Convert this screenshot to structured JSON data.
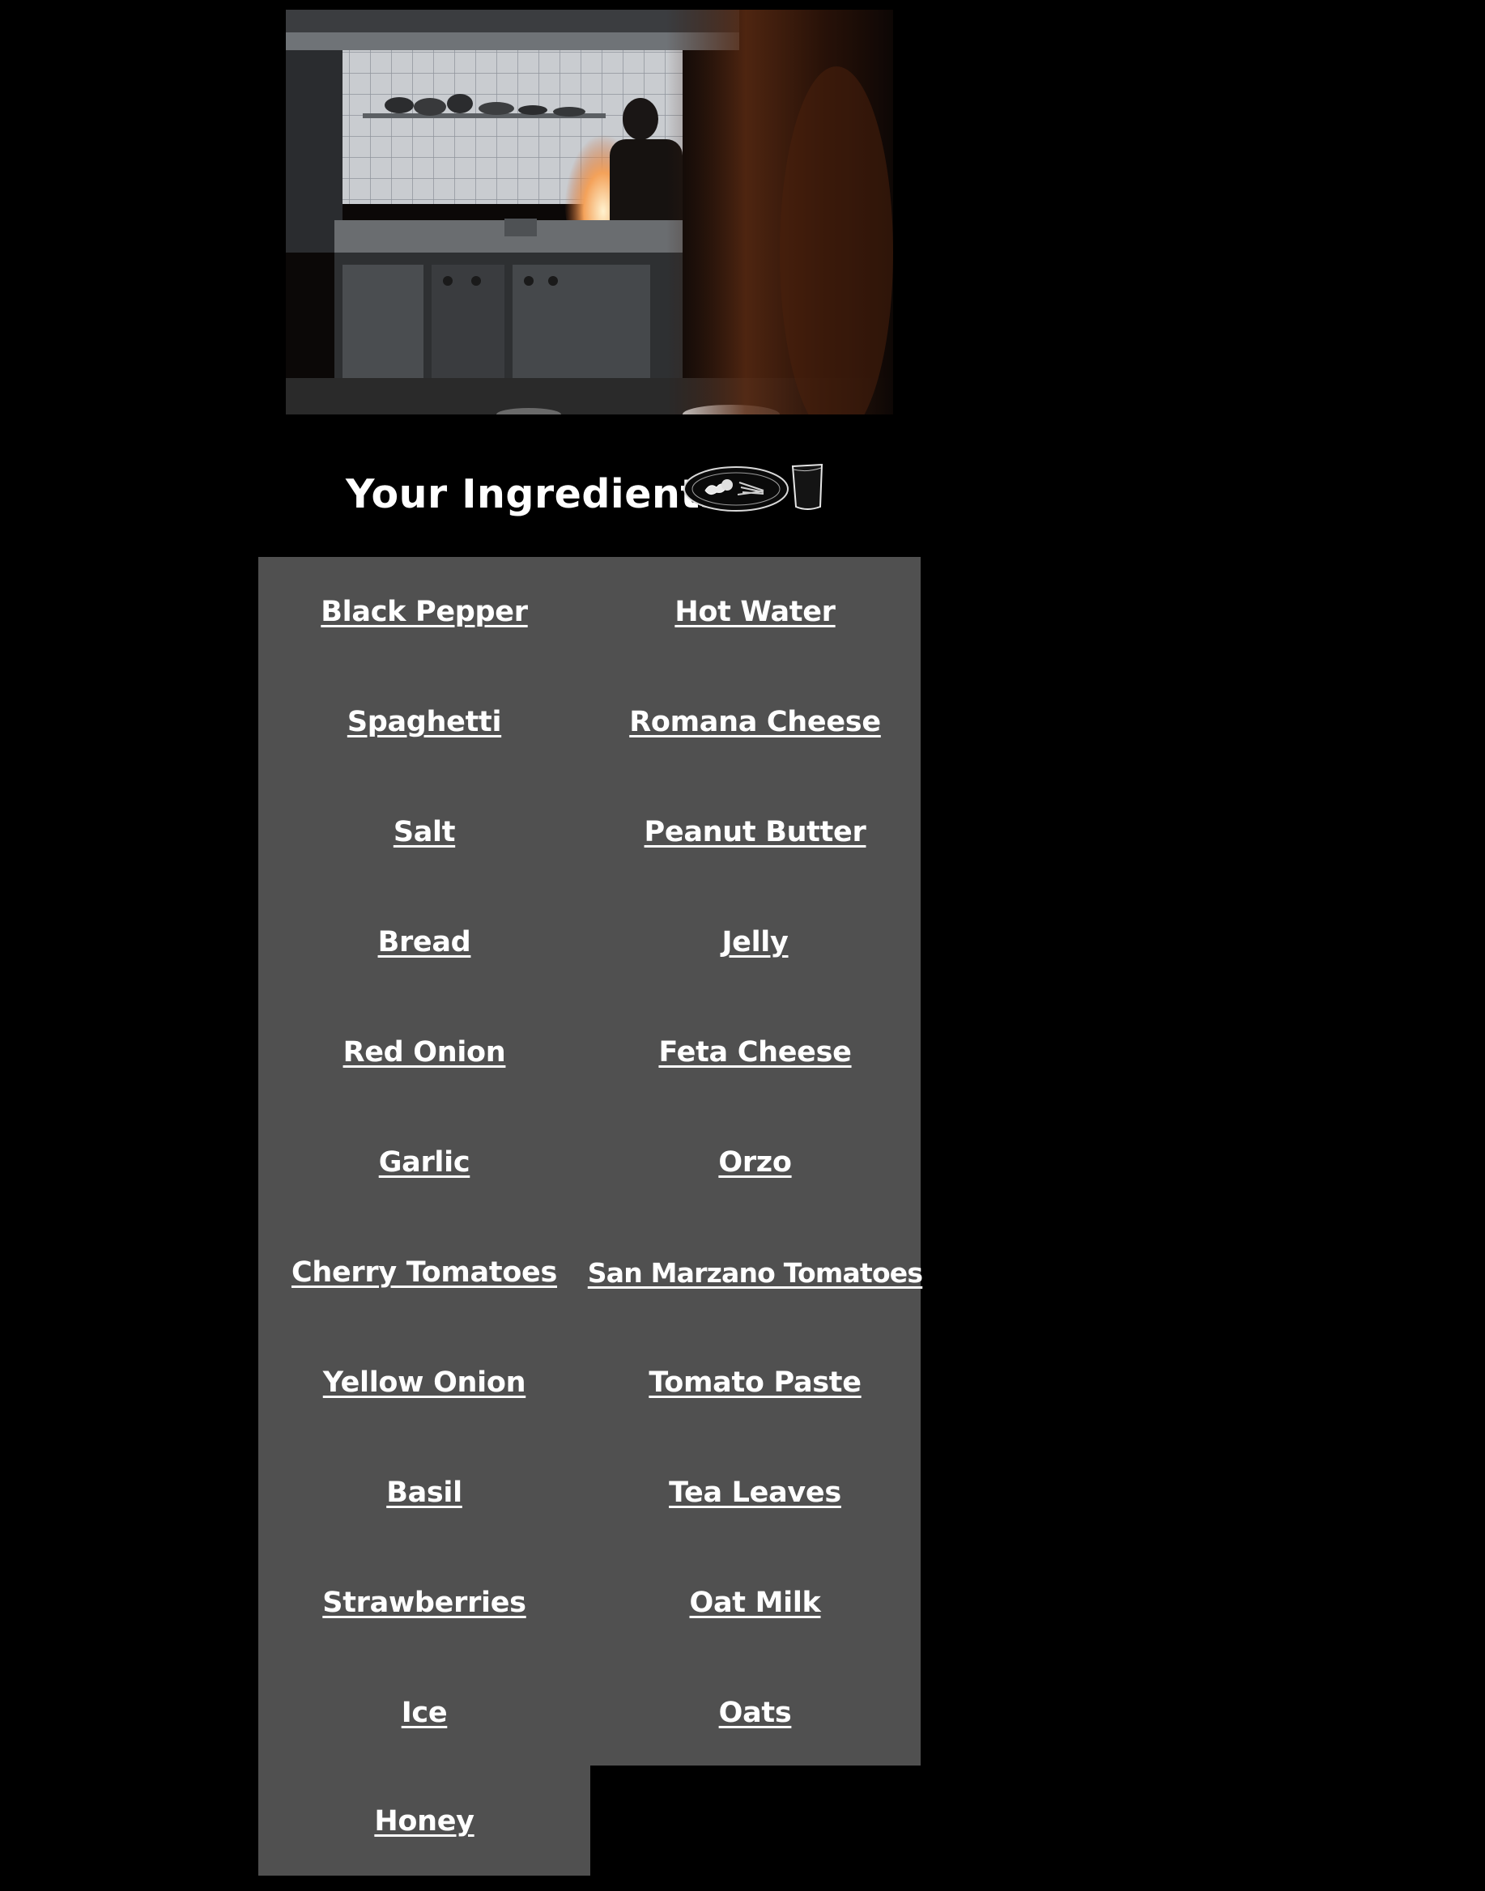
{
  "hero_image": {
    "description_icon": "kitchen-photo"
  },
  "heading": {
    "title": "Your Ingredients",
    "icon": "plate-and-cup-icon"
  },
  "colors": {
    "background": "#000000",
    "panel": "#505050",
    "text": "#ffffff"
  },
  "ingredients": {
    "left": [
      "Black Pepper",
      "Spaghetti",
      "Salt",
      "Bread",
      "Red Onion",
      "Garlic",
      "Cherry Tomatoes",
      "Yellow Onion",
      "Basil",
      "Strawberries",
      "Ice",
      "Honey"
    ],
    "right": [
      "Hot Water",
      "Romana Cheese",
      "Peanut Butter",
      "Jelly",
      "Feta Cheese",
      "Orzo",
      "San Marzano Tomatoes",
      "Tomato Paste",
      "Tea Leaves",
      "Oat Milk",
      "Oats"
    ]
  }
}
